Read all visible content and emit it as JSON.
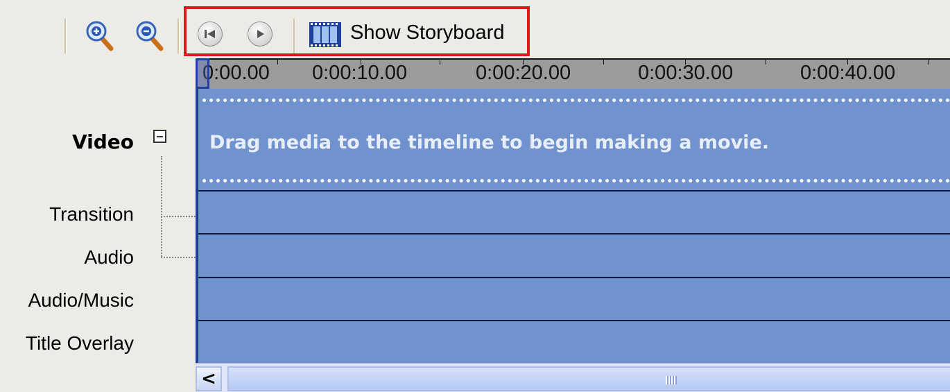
{
  "toolbar": {
    "zoom_in_icon": "zoom-in-icon",
    "zoom_out_icon": "zoom-out-icon",
    "rewind_icon": "rewind-icon",
    "play_icon": "play-icon",
    "storyboard_icon": "filmstrip-icon",
    "show_storyboard_label": "Show Storyboard",
    "highlight_color": "#e3141b"
  },
  "tracks": {
    "video_label": "Video",
    "transition_label": "Transition",
    "audio_label": "Audio",
    "audio_music_label": "Audio/Music",
    "title_overlay_label": "Title Overlay"
  },
  "ruler": {
    "ticks": [
      "0:00.00",
      "0:00:10.00",
      "0:00:20.00",
      "0:00:30.00",
      "0:00:40.00"
    ]
  },
  "timeline": {
    "drag_message": "Drag media to the timeline to begin making a movie.",
    "track_color": "#7092cf"
  },
  "scrollbar": {
    "left_arrow": "<"
  }
}
